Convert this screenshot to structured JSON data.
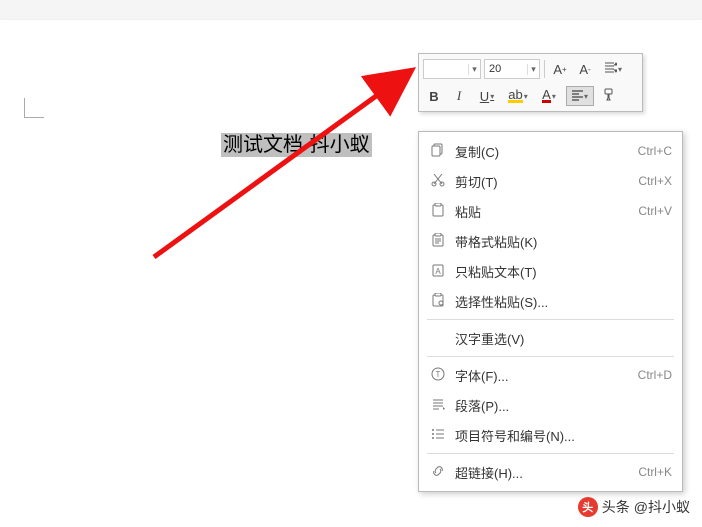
{
  "document": {
    "selected_text": "测试文档-抖小蚁"
  },
  "toolbar": {
    "font_name": "",
    "font_size": "20",
    "increase_font": "A",
    "decrease_font": "A",
    "bold": "B",
    "italic": "I",
    "underline": "U"
  },
  "context_menu": {
    "items": [
      {
        "icon": "copy",
        "label": "复制(C)",
        "shortcut": "Ctrl+C"
      },
      {
        "icon": "cut",
        "label": "剪切(T)",
        "shortcut": "Ctrl+X"
      },
      {
        "icon": "paste",
        "label": "粘贴",
        "shortcut": "Ctrl+V"
      },
      {
        "icon": "pastefmt",
        "label": "带格式粘贴(K)",
        "shortcut": ""
      },
      {
        "icon": "pastetxt",
        "label": "只粘贴文本(T)",
        "shortcut": ""
      },
      {
        "icon": "pastespc",
        "label": "选择性粘贴(S)...",
        "shortcut": ""
      },
      {
        "divider": true
      },
      {
        "icon": "",
        "label": "汉字重选(V)",
        "shortcut": ""
      },
      {
        "divider": true
      },
      {
        "icon": "font",
        "label": "字体(F)...",
        "shortcut": "Ctrl+D"
      },
      {
        "icon": "para",
        "label": "段落(P)...",
        "shortcut": ""
      },
      {
        "icon": "bullets",
        "label": "项目符号和编号(N)...",
        "shortcut": ""
      },
      {
        "divider": true
      },
      {
        "icon": "link",
        "label": "超链接(H)...",
        "shortcut": "Ctrl+K"
      }
    ]
  },
  "watermark": {
    "prefix": "头条",
    "at": "@抖小蚁"
  }
}
